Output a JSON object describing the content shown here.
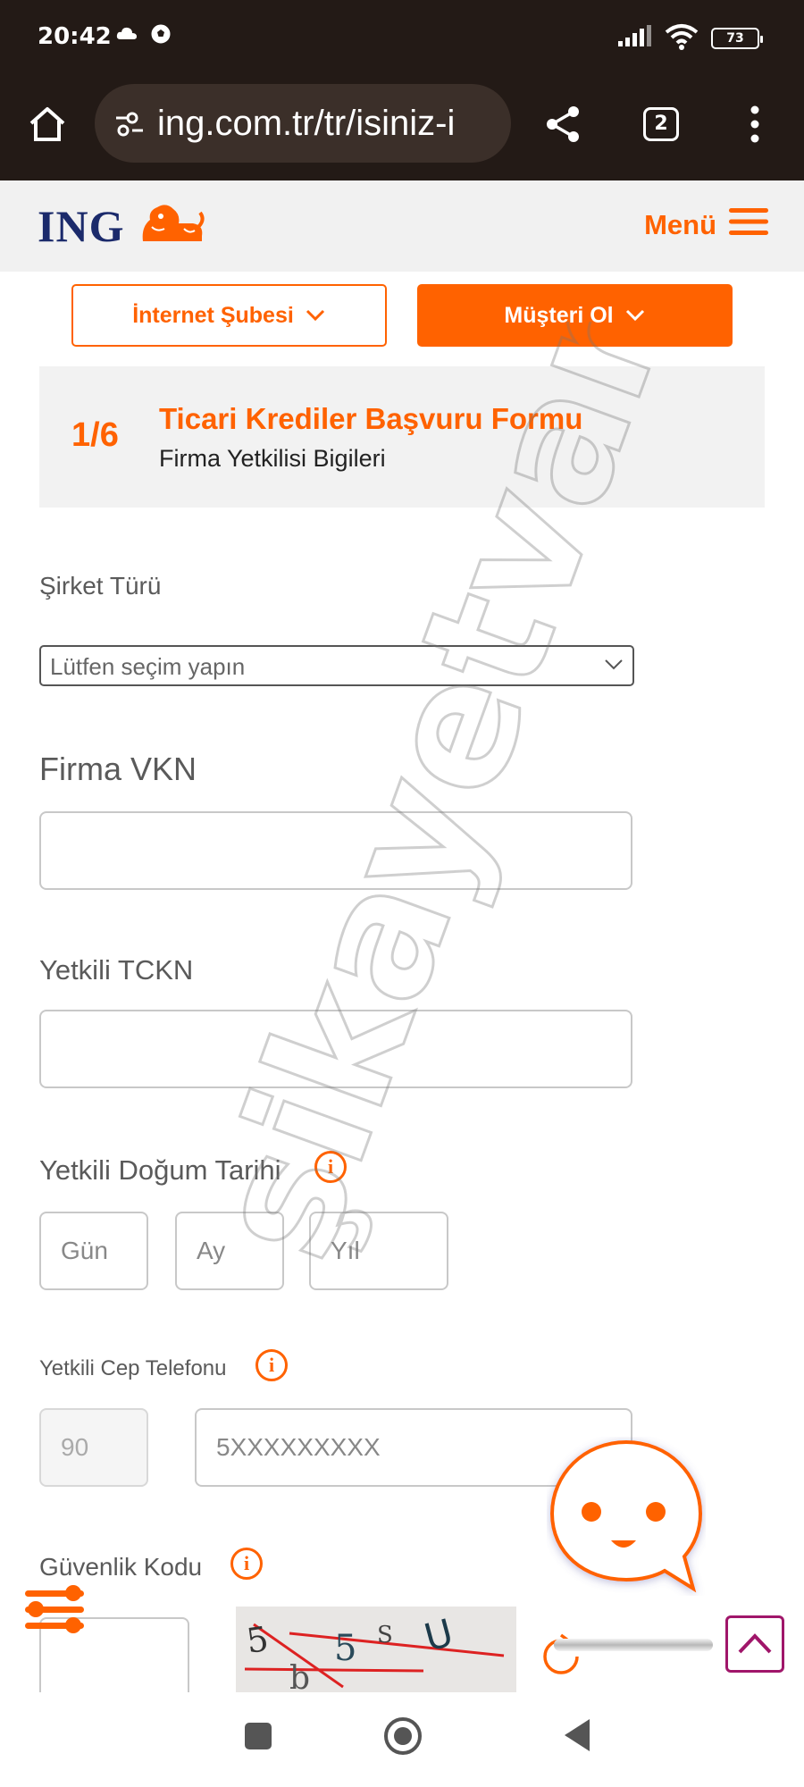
{
  "status_bar": {
    "time": "20:42",
    "icons_left": [
      "cloud-icon",
      "soccer-ball-icon"
    ],
    "icons_right": [
      "signal-icon",
      "wifi-icon",
      "battery-icon"
    ],
    "battery_level": "73"
  },
  "browser": {
    "url": "ing.com.tr/tr/isiniz-i",
    "tab_count": "2",
    "icons": [
      "home-icon",
      "site-settings-icon",
      "share-icon",
      "tabs-icon",
      "more-icon"
    ]
  },
  "header": {
    "logo_text": "ING",
    "menu_label": "Menü"
  },
  "top_buttons": {
    "internet_subesi": "İnternet Şubesi",
    "musteri_ol": "Müşteri Ol"
  },
  "step": {
    "number": "1/6",
    "title": "Ticari Krediler Başvuru Formu",
    "subtitle": "Firma Yetkilisi Bigileri"
  },
  "form": {
    "sirket_turu_label": "Şirket Türü",
    "sirket_turu_value": "Lütfen seçim yapın",
    "firma_vkn_label": "Firma VKN",
    "firma_vkn_value": "",
    "yetkili_tckn_label": "Yetkili TCKN",
    "yetkili_tckn_value": "",
    "dogum_tarihi_label": "Yetkili Doğum Tarihi",
    "gun_placeholder": "Gün",
    "ay_placeholder": "Ay",
    "yil_placeholder": "Yıl",
    "cep_telefonu_label": "Yetkili Cep Telefonu",
    "country_code": "90",
    "phone_placeholder": "5XXXXXXXXX",
    "guvenlik_kodu_label": "Güvenlik Kodu",
    "captcha_text": "5 5 5 U"
  },
  "watermark": "şikayetvar",
  "colors": {
    "brand_orange": "#ff6200",
    "brand_navy": "#1b2a6b",
    "browser_bg": "#231a16",
    "scroll_top_border": "#a0166a"
  }
}
